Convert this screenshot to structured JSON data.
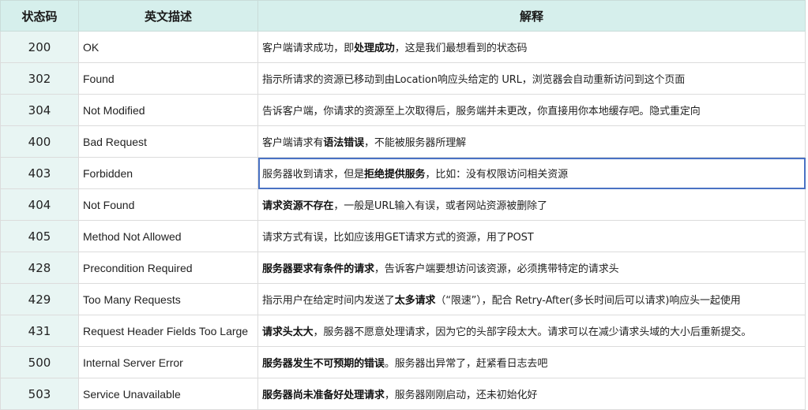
{
  "header": {
    "col_code": "状态码",
    "col_english": "英文描述",
    "col_explain": "解释"
  },
  "rows": [
    {
      "code": "200",
      "english": "OK",
      "segments": [
        {
          "t": "客户端请求成功，即",
          "b": false
        },
        {
          "t": "处理成功",
          "b": true
        },
        {
          "t": "，这是我们最想看到的状态码",
          "b": false
        }
      ]
    },
    {
      "code": "302",
      "english": "Found",
      "segments": [
        {
          "t": "指示所请求的资源已移动到由Location响应头给定的 URL，浏览器会自动重新访问到这个页面",
          "b": false
        }
      ]
    },
    {
      "code": "304",
      "english": "Not Modified",
      "segments": [
        {
          "t": "告诉客户端，你请求的资源至上次取得后，服务端并未更改，你直接用你本地缓存吧。隐式重定向",
          "b": false
        }
      ]
    },
    {
      "code": "400",
      "english": "Bad Request",
      "segments": [
        {
          "t": "客户端请求有",
          "b": false
        },
        {
          "t": "语法错误",
          "b": true
        },
        {
          "t": "，不能被服务器所理解",
          "b": false
        }
      ]
    },
    {
      "code": "403",
      "english": "Forbidden",
      "selected": true,
      "segments": [
        {
          "t": "服务器收到请求，但是",
          "b": false
        },
        {
          "t": "拒绝提供服务",
          "b": true
        },
        {
          "t": "，比如：没有权限访问相关资源",
          "b": false
        }
      ]
    },
    {
      "code": "404",
      "english": "Not Found",
      "segments": [
        {
          "t": "请求资源不存在",
          "b": true
        },
        {
          "t": "，一般是URL输入有误，或者网站资源被删除了",
          "b": false
        }
      ]
    },
    {
      "code": "405",
      "english": "Method Not Allowed",
      "segments": [
        {
          "t": "请求方式有误，比如应该用GET请求方式的资源，用了POST",
          "b": false
        }
      ]
    },
    {
      "code": "428",
      "english": "Precondition Required",
      "segments": [
        {
          "t": "服务器要求有条件的请求",
          "b": true
        },
        {
          "t": "，告诉客户端要想访问该资源，必须携带特定的请求头",
          "b": false
        }
      ]
    },
    {
      "code": "429",
      "english": "Too Many Requests",
      "segments": [
        {
          "t": "指示用户在给定时间内发送了",
          "b": false
        },
        {
          "t": "太多请求",
          "b": true
        },
        {
          "t": "（“限速”），配合 Retry-After(多长时间后可以请求)响应头一起使用",
          "b": false
        }
      ]
    },
    {
      "code": "431",
      "english": "Request Header Fields Too Large",
      "segments": [
        {
          "t": "请求头太大",
          "b": true
        },
        {
          "t": "，服务器不愿意处理请求，因为它的头部字段太大。请求可以在减少请求头域的大小后重新提交。",
          "b": false
        }
      ]
    },
    {
      "code": "500",
      "english": "Internal Server Error",
      "segments": [
        {
          "t": "服务器发生不可预期的错误",
          "b": true
        },
        {
          "t": "。服务器出异常了，赶紧看日志去吧",
          "b": false
        }
      ]
    },
    {
      "code": "503",
      "english": "Service Unavailable",
      "segments": [
        {
          "t": "服务器尚未准备好处理请求",
          "b": true
        },
        {
          "t": "，服务器刚刚启动，还未初始化好",
          "b": false
        }
      ]
    }
  ]
}
